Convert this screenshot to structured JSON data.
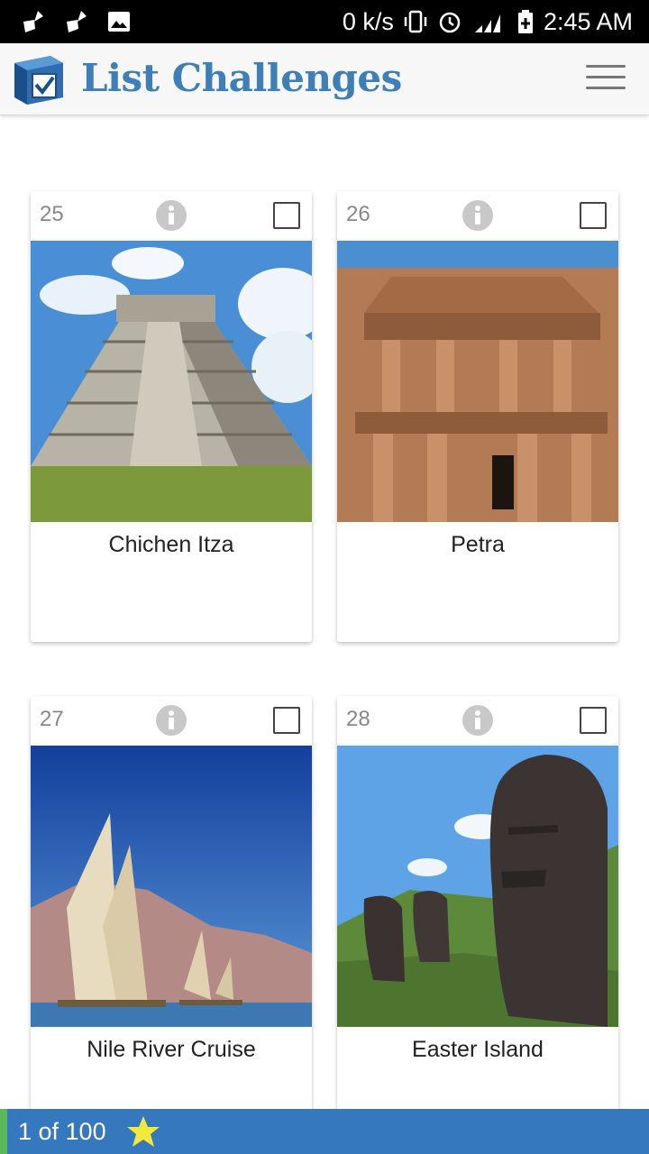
{
  "status": {
    "speed": "0 k/s",
    "time": "2:45 AM",
    "icons": [
      "broom-icon",
      "broom-icon",
      "image-icon",
      "vibrate-icon",
      "alarm-icon",
      "signal-icon",
      "battery-icon"
    ]
  },
  "app": {
    "brand": "List Challenges",
    "menu_icon": "hamburger-icon"
  },
  "cards": [
    {
      "number": "25",
      "title": "Chichen Itza",
      "checked": false
    },
    {
      "number": "26",
      "title": "Petra",
      "checked": false
    },
    {
      "number": "27",
      "title": "Nile River Cruise",
      "checked": false
    },
    {
      "number": "28",
      "title": "Easter Island",
      "checked": false
    }
  ],
  "footer": {
    "counter": "1 of 100",
    "star_icon": "star-icon"
  },
  "colors": {
    "brand": "#3f7fb8",
    "footer": "#3578bd",
    "footer_accent": "#5cb85c",
    "star": "#f2e93a"
  }
}
